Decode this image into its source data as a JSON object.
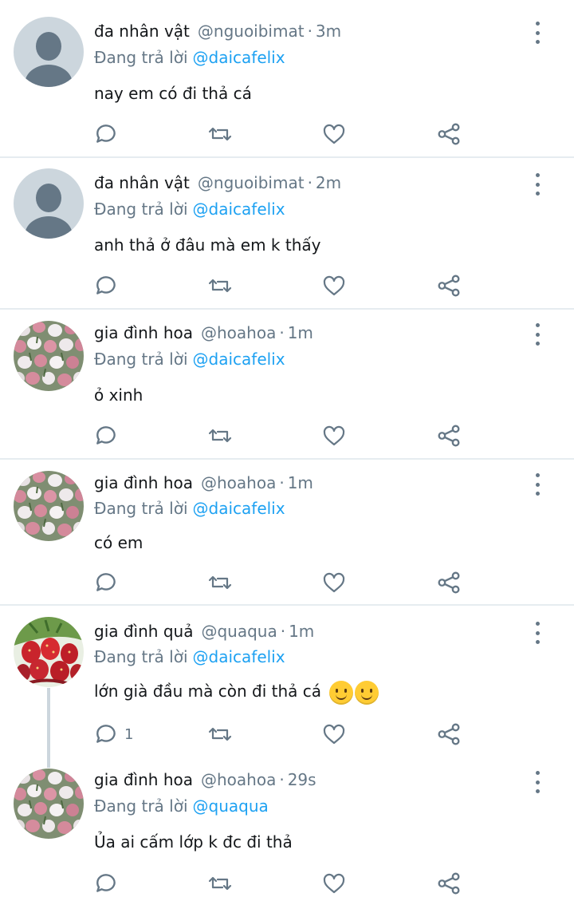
{
  "colors": {
    "accent": "#1da1f2",
    "muted": "#657786",
    "divider": "#e6ecf0"
  },
  "reply_prefix": "Đang trả lời",
  "tweets": [
    {
      "name": "đa nhân vật",
      "handle": "@nguoibimat",
      "time": "3m",
      "reply_to": "@daicafelix",
      "text": "nay em có đi thả cá",
      "avatar": "default-avatar",
      "reply_count": ""
    },
    {
      "name": "đa nhân vật",
      "handle": "@nguoibimat",
      "time": "2m",
      "reply_to": "@daicafelix",
      "text": "anh thả ở đâu mà em k thấy",
      "avatar": "default-avatar",
      "reply_count": ""
    },
    {
      "name": "gia đình hoa",
      "handle": "@hoahoa",
      "time": "1m",
      "reply_to": "@daicafelix",
      "text": "ỏ xinh",
      "avatar": "flowers-avatar",
      "reply_count": ""
    },
    {
      "name": "gia đình hoa",
      "handle": "@hoahoa",
      "time": "1m",
      "reply_to": "@daicafelix",
      "text": "có em",
      "avatar": "flowers-avatar",
      "reply_count": ""
    },
    {
      "name": "gia đình quả",
      "handle": "@quaqua",
      "time": "1m",
      "reply_to": "@daicafelix",
      "text": "lớn già đầu mà còn đi thả cá",
      "avatar": "strawberry-avatar",
      "reply_count": "1",
      "emoji": [
        "slightly-smiling-face",
        "slightly-smiling-face"
      ]
    },
    {
      "name": "gia đình hoa",
      "handle": "@hoahoa",
      "time": "29s",
      "reply_to": "@quaqua",
      "text": "Ủa ai cấm lớp k đc đi thả",
      "avatar": "flowers-avatar",
      "reply_count": ""
    }
  ]
}
